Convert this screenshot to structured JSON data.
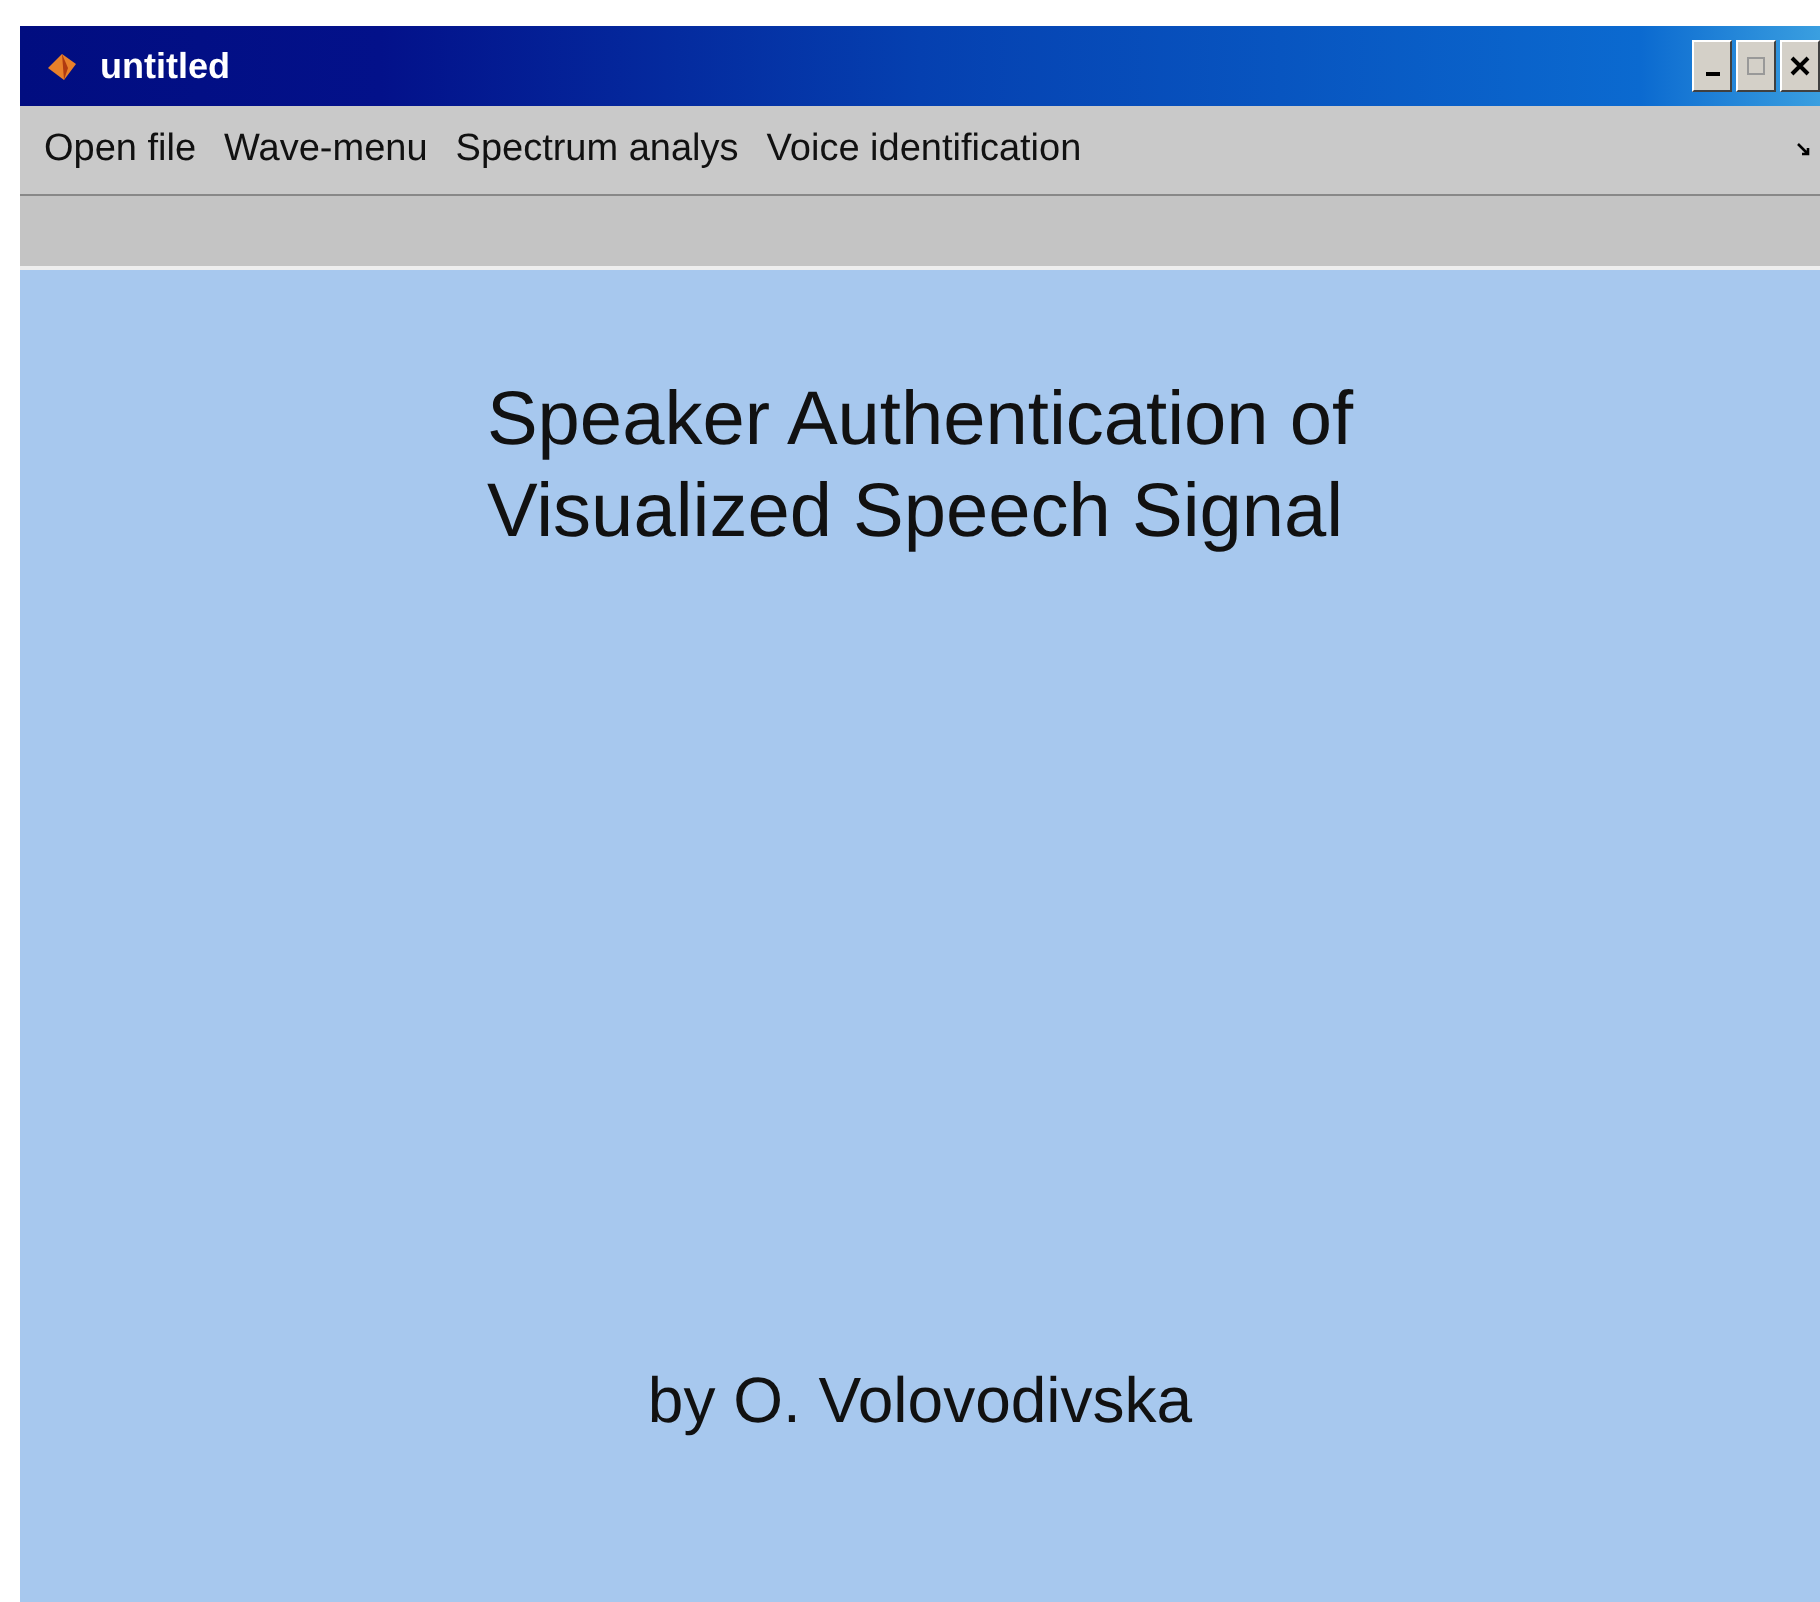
{
  "window": {
    "title": "untitled"
  },
  "menu": [
    {
      "label": "Open file"
    },
    {
      "label": "Wave-menu"
    },
    {
      "label": "Spectrum analys"
    },
    {
      "label": "Voice identification"
    }
  ],
  "content": {
    "title_lines": [
      "Speaker Authentication of",
      "Visualized Speech Signal"
    ],
    "author": "by O. Volovodivska"
  }
}
